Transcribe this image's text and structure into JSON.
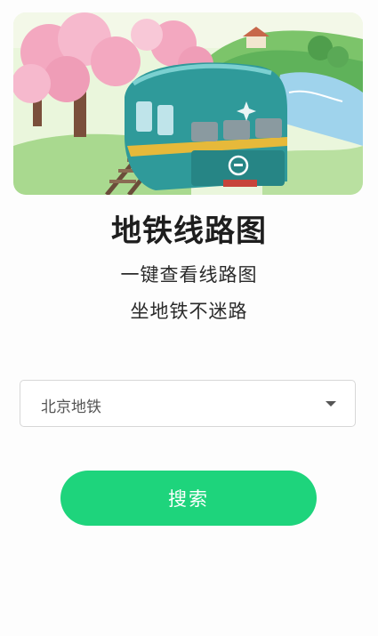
{
  "header": {
    "title": "地铁线路图",
    "subtitle_line1": "一键查看线路图",
    "subtitle_line2": "坐地铁不迷路"
  },
  "city_select": {
    "value": "北京地铁"
  },
  "search_button": {
    "label": "搜索"
  },
  "colors": {
    "accent": "#1ed47c",
    "train_body": "#2f9a9a",
    "blossom": "#f3a8c0"
  }
}
